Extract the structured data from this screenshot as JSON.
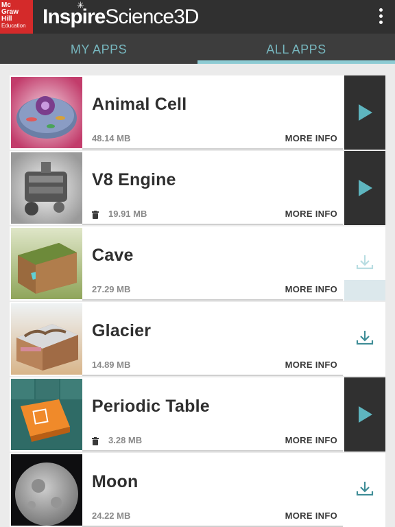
{
  "brand": {
    "logo_lines": [
      "Mc",
      "Graw",
      "Hill",
      "Education"
    ],
    "title_part1": "Inspire",
    "title_part2": "Science3D",
    "logo_color": "#d42a2a"
  },
  "tabs": [
    {
      "label": "MY APPS",
      "active": false
    },
    {
      "label": "ALL APPS",
      "active": true
    }
  ],
  "colors": {
    "accent": "#5eb5bf",
    "header": "#303030",
    "tabbar": "#3d3d3d"
  },
  "apps": [
    {
      "name": "Animal Cell",
      "size": "48.14 MB",
      "more": "MORE INFO",
      "installed": false,
      "action": "play",
      "action_icon": "play-icon"
    },
    {
      "name": "V8 Engine",
      "size": "19.91 MB",
      "more": "MORE INFO",
      "installed": true,
      "action": "play",
      "action_icon": "play-icon"
    },
    {
      "name": "Cave",
      "size": "27.29 MB",
      "more": "MORE INFO",
      "installed": false,
      "action": "downloading",
      "action_icon": "download-icon",
      "download_progress": 0.28
    },
    {
      "name": "Glacier",
      "size": "14.89 MB",
      "more": "MORE INFO",
      "installed": false,
      "action": "download",
      "action_icon": "download-icon"
    },
    {
      "name": "Periodic Table",
      "size": "3.28 MB",
      "more": "MORE INFO",
      "installed": true,
      "action": "play",
      "action_icon": "play-icon"
    },
    {
      "name": "Moon",
      "size": "24.22 MB",
      "more": "MORE INFO",
      "installed": false,
      "action": "download",
      "action_icon": "download-icon"
    }
  ]
}
